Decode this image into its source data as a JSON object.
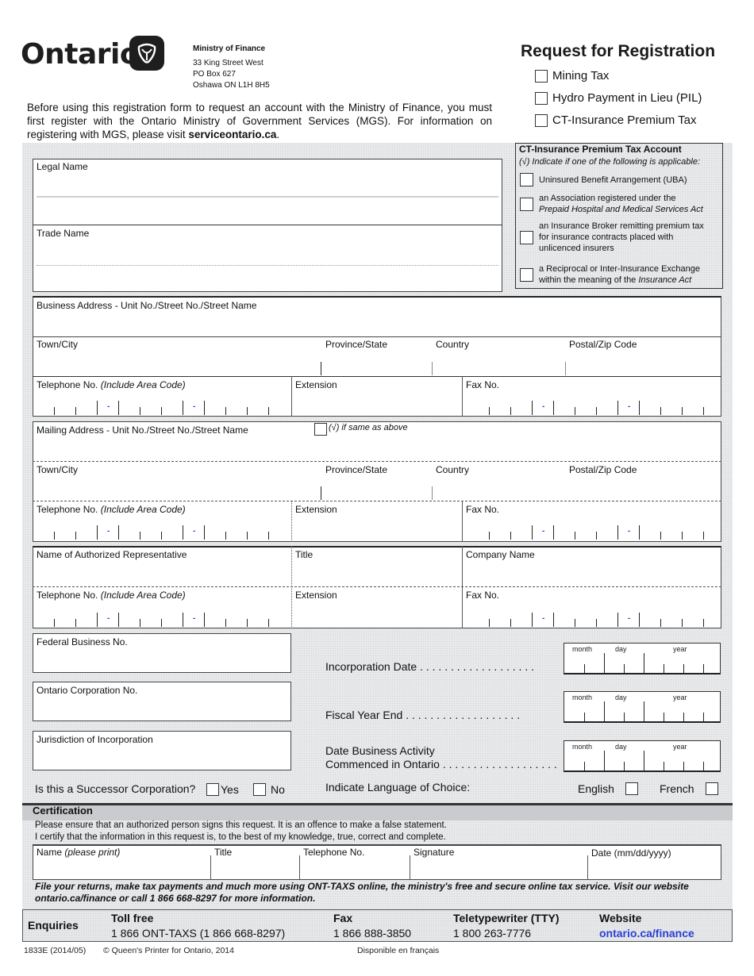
{
  "header": {
    "logo_text": "Ontario",
    "logo_icon": "trillium-icon",
    "ministry_name": "Ministry of Finance",
    "address_lines": [
      "33 King Street West",
      "PO Box 627",
      "Oshawa ON  L1H 8H5"
    ],
    "form_title": "Request for Registration",
    "options": [
      "Mining Tax",
      "Hydro Payment in Lieu (PIL)",
      "CT-Insurance Premium Tax"
    ]
  },
  "intro": {
    "text": "Before using this registration form to request an account with the Ministry of Finance, you must first register with the Ontario Ministry of Government Services (MGS). For information on registering with MGS, please visit ",
    "link": "serviceontario.ca",
    "end": "."
  },
  "ct_account": {
    "title": "CT-Insurance Premium Tax Account",
    "subtitle": "(√) Indicate if one of the following is applicable:",
    "items": [
      {
        "text": "Uninsured Benefit Arrangement (UBA)",
        "italic": ""
      },
      {
        "text": "an Association registered under the",
        "italic": "Prepaid Hospital and Medical Services Act"
      },
      {
        "text": "an Insurance Broker remitting premium tax for insurance contracts placed with unlicenced insurers",
        "italic": ""
      },
      {
        "text": "a Reciprocal or Inter-Insurance Exchange within the meaning of the ",
        "italic": "Insurance Act"
      }
    ]
  },
  "fields": {
    "legal_name": "Legal Name",
    "trade_name": "Trade Name",
    "business_address": "Business Address - Unit No./Street No./Street Name",
    "town_city": "Town/City",
    "province_state": "Province/State",
    "country": "Country",
    "postal_zip": "Postal/Zip Code",
    "telephone": "Telephone No.",
    "include_area_code": "(Include Area Code)",
    "extension": "Extension",
    "fax": "Fax No.",
    "mailing_address": "Mailing Address - Unit No./Street No./Street Name",
    "same_as_above": "(√) if same as above",
    "auth_rep": "Name of Authorized Representative",
    "title": "Title",
    "company_name": "Company Name",
    "federal_business_no": "Federal Business No.",
    "ontario_corp_no": "Ontario Corporation No.",
    "jurisdiction": "Jurisdiction of Incorporation",
    "incorporation_date": "Incorporation Date",
    "fiscal_year_end": "Fiscal Year End",
    "date_commenced_1": "Date Business Activity",
    "date_commenced_2": "Commenced in Ontario",
    "date_month": "month",
    "date_day": "day",
    "date_year": "year",
    "dots": ". . . . . . . . . . . . . . . . . . .",
    "successor_q": "Is this a Successor Corporation?",
    "yes": "Yes",
    "no": "No",
    "language_q": "Indicate Language of Choice:",
    "english": "English",
    "french": "French",
    "phone_dash": "-"
  },
  "certification": {
    "title": "Certification",
    "line1": "Please ensure that an authorized person signs this request.  It is an offence to make a false statement.",
    "line2": "I certify that the information in this request is, to the best of my knowledge, true, correct and complete.",
    "name_label": "Name",
    "name_hint": "(please print)",
    "title_label": "Title",
    "telephone_label": "Telephone No.",
    "signature_label": "Signature",
    "date_label": "Date (mm/dd/yyyy)",
    "promo": "File your returns, make tax payments and much more using ONT-TAXS online, the ministry's free and secure online tax service.  Visit our website ontario.ca/finance or call 1 866 668-8297 for more information."
  },
  "enquiries": {
    "label": "Enquiries",
    "toll_free_h": "Toll free",
    "toll_free_v": "1 866 ONT-TAXS (1 866 668-8297)",
    "fax_h": "Fax",
    "fax_v": "1 866 888-3850",
    "tty_h": "Teletypewriter (TTY)",
    "tty_v": "1 800 263-7776",
    "website_h": "Website",
    "website_v": "ontario.ca/finance",
    "link_color": "#2a3fd8"
  },
  "footer": {
    "form_no": "1833E (2014/05)",
    "copyright": "© Queen's Printer for Ontario, 2014",
    "french": "Disponible en français"
  }
}
